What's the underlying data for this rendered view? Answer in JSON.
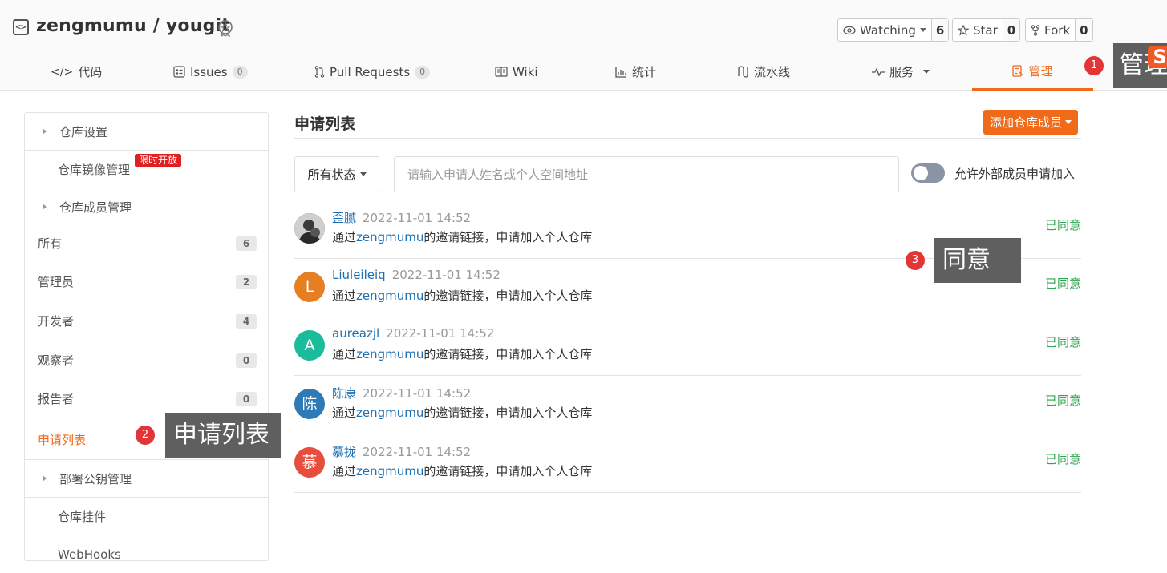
{
  "repo": {
    "title": "zengmumu / yougit",
    "icon": "repo-code-icon",
    "badge_icon": "certificate-badge-icon"
  },
  "actions": {
    "watching": {
      "label": "Watching",
      "count": "6",
      "icon": "eye-icon"
    },
    "star": {
      "label": "Star",
      "count": "0",
      "icon": "star-icon"
    },
    "fork": {
      "label": "Fork",
      "count": "0",
      "icon": "fork-icon"
    }
  },
  "nav": {
    "code": {
      "label": "代码",
      "icon": "code-icon"
    },
    "issues": {
      "label": "Issues",
      "count": "0",
      "icon": "issues-icon"
    },
    "pull_requests": {
      "label": "Pull Requests",
      "count": "0",
      "icon": "pull-request-icon"
    },
    "wiki": {
      "label": "Wiki",
      "icon": "book-icon"
    },
    "stats": {
      "label": "统计",
      "icon": "bar-chart-icon"
    },
    "pipeline": {
      "label": "流水线",
      "icon": "pipeline-icon"
    },
    "services": {
      "label": "服务",
      "icon": "pulse-icon"
    },
    "manage": {
      "label": "管理",
      "icon": "manage-icon"
    }
  },
  "annotations": {
    "one": {
      "num": "1",
      "text": "管理"
    },
    "two": {
      "num": "2",
      "text": "申请列表"
    },
    "three": {
      "num": "3",
      "text": "同意"
    },
    "logo_letter": "S"
  },
  "sidebar": {
    "repo_settings": "仓库设置",
    "mirror": "仓库镜像管理",
    "mirror_badge": "限时开放",
    "members_section": "仓库成员管理",
    "all": {
      "label": "所有",
      "count": "6"
    },
    "admins": {
      "label": "管理员",
      "count": "2"
    },
    "developers": {
      "label": "开发者",
      "count": "4"
    },
    "observers": {
      "label": "观察者",
      "count": "0"
    },
    "reporters": {
      "label": "报告者",
      "count": "0"
    },
    "applications": "申请列表",
    "deploy_keys": "部署公钥管理",
    "hooks": "仓库挂件",
    "webhooks": "WebHooks"
  },
  "main": {
    "title": "申请列表",
    "add_member_button": "添加仓库成员",
    "status_filter": "所有状态",
    "search_placeholder": "请输入申请人姓名或个人空间地址",
    "allow_external_label": "允许外部成员申请加入",
    "allow_external_on": false
  },
  "applications": [
    {
      "name": "歪腻",
      "time": "2022-11-01 14:52",
      "desc_prefix": "通过",
      "desc_user": "zengmumu",
      "desc_suffix": "的邀请链接，申请加入个人仓库",
      "status": "已同意",
      "avatar_letter": "",
      "avatar_color": "#3a3a3a"
    },
    {
      "name": "Liuleileiq",
      "time": "2022-11-01 14:52",
      "desc_prefix": "通过",
      "desc_user": "zengmumu",
      "desc_suffix": "的邀请链接，申请加入个人仓库",
      "status": "已同意",
      "avatar_letter": "L",
      "avatar_color": "#e67e22"
    },
    {
      "name": "aureazjl",
      "time": "2022-11-01 14:52",
      "desc_prefix": "通过",
      "desc_user": "zengmumu",
      "desc_suffix": "的邀请链接，申请加入个人仓库",
      "status": "已同意",
      "avatar_letter": "A",
      "avatar_color": "#1abc9c"
    },
    {
      "name": "陈康",
      "time": "2022-11-01 14:52",
      "desc_prefix": "通过",
      "desc_user": "zengmumu",
      "desc_suffix": "的邀请链接，申请加入个人仓库",
      "status": "已同意",
      "avatar_letter": "陈",
      "avatar_color": "#2e7ab6"
    },
    {
      "name": "慕拢",
      "time": "2022-11-01 14:52",
      "desc_prefix": "通过",
      "desc_user": "zengmumu",
      "desc_suffix": "的邀请链接，申请加入个人仓库",
      "status": "已同意",
      "avatar_letter": "慕",
      "avatar_color": "#e74c3c"
    }
  ],
  "colors": {
    "accent": "#f06a1a",
    "link": "#1e6fb2",
    "approved": "#2da44e",
    "annotation_dot": "#e23535",
    "annotation_box": "#5f5f5f"
  }
}
